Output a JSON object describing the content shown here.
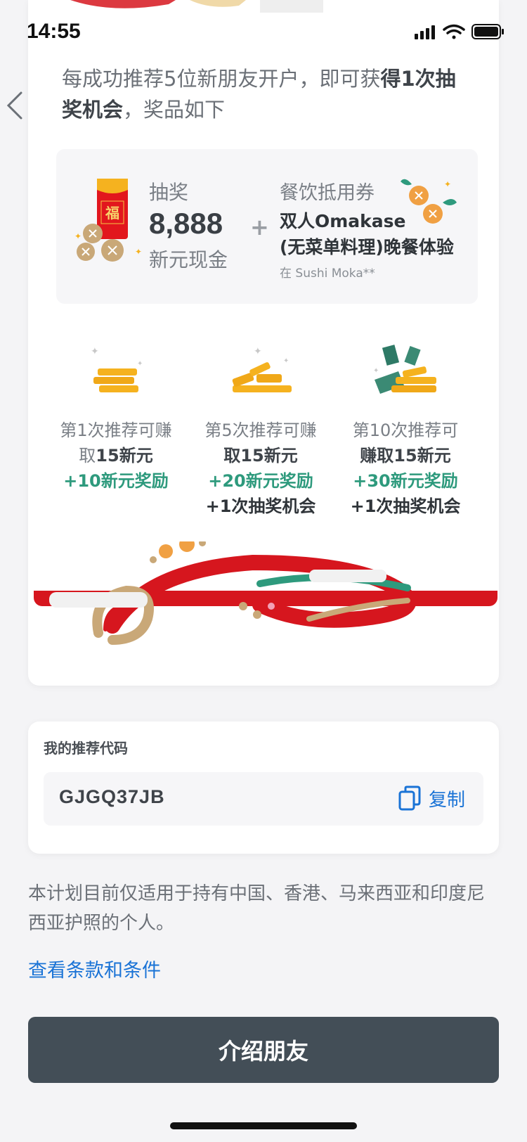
{
  "status": {
    "time": "14:55"
  },
  "intro": {
    "text_a": "每成功推荐5位新朋友开户，即可获",
    "text_b": "得1次抽奖机会",
    "text_c": "，奖品如下"
  },
  "prize": {
    "label": "抽奖",
    "amount": "8,888",
    "unit": "新元现金",
    "plus": "+",
    "redpack_char": "福",
    "voucher_title": "餐饮抵用券",
    "voucher_line1": "双人Omakase",
    "voucher_line2": "(无菜单料理)晚餐体验",
    "voucher_sub": "在 Sushi Moka**"
  },
  "tiers": [
    {
      "line1": "第1次推荐可赚",
      "line2_a": "取",
      "line2_b": "15新元",
      "bonus": "+10新元奖励",
      "extra": ""
    },
    {
      "line1": "第5次推荐可赚",
      "line2_a": "",
      "line2_b": "取15新元",
      "bonus": "+20新元奖励",
      "extra": "+1次抽奖机会"
    },
    {
      "line1": "第10次推荐可",
      "line2_a": "",
      "line2_b": "赚取15新元",
      "bonus": "+30新元奖励",
      "extra": "+1次抽奖机会"
    }
  ],
  "referral": {
    "label": "我的推荐代码",
    "code": "GJGQ37JB",
    "copy_label": "复制"
  },
  "footer": {
    "disclaimer": "本计划目前仅适用于持有中国、香港、马来西亚和印度尼西亚护照的个人。",
    "terms_link": "查看条款和条件",
    "cta_label": "介绍朋友"
  },
  "colors": {
    "accent_blue": "#1a73d6",
    "bonus_green": "#2e9a7d",
    "festive_red": "#d6161e",
    "gold": "#f5b21f",
    "cta_bg": "#434e57"
  }
}
